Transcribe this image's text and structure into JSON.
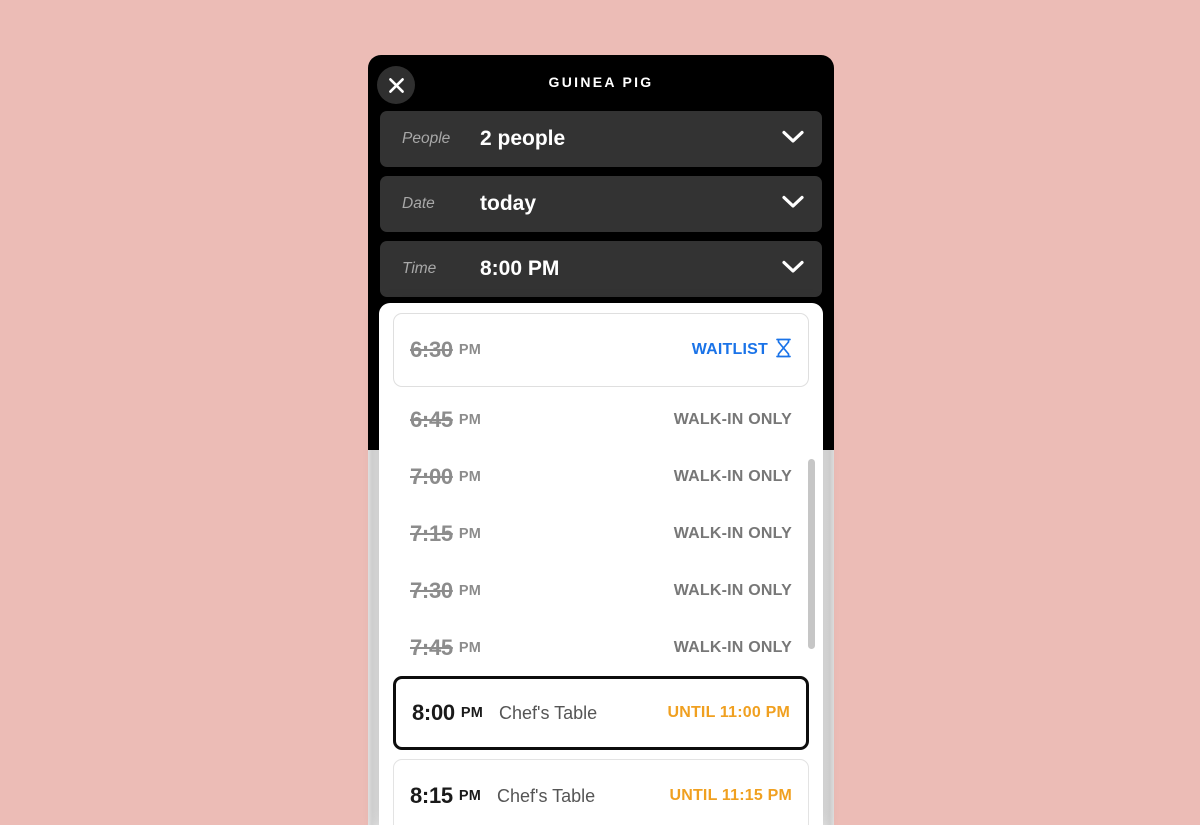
{
  "background_color": "#ecbcb6",
  "modal": {
    "title": "GUINEA PIG",
    "close_icon": "close-icon",
    "background_color": "#000000",
    "fields": [
      {
        "label": "People",
        "value": "2 people",
        "icon": "chevron-down-icon"
      },
      {
        "label": "Date",
        "value": "today",
        "icon": "chevron-down-icon"
      },
      {
        "label": "Time",
        "value": "8:00 PM",
        "icon": "chevron-down-icon"
      }
    ]
  },
  "time_dropdown": {
    "accent_waitlist": "#1a73e8",
    "accent_until": "#f0a020",
    "slots": [
      {
        "time": "6:30",
        "ampm": "PM",
        "desc": "",
        "status": "WAITLIST",
        "status_type": "waitlist",
        "icon": "hourglass-icon",
        "struck": true,
        "style": "boxed"
      },
      {
        "time": "6:45",
        "ampm": "PM",
        "desc": "",
        "status": "WALK-IN ONLY",
        "status_type": "plain",
        "icon": "",
        "struck": true,
        "style": "plain"
      },
      {
        "time": "7:00",
        "ampm": "PM",
        "desc": "",
        "status": "WALK-IN ONLY",
        "status_type": "plain",
        "icon": "",
        "struck": true,
        "style": "plain"
      },
      {
        "time": "7:15",
        "ampm": "PM",
        "desc": "",
        "status": "WALK-IN ONLY",
        "status_type": "plain",
        "icon": "",
        "struck": true,
        "style": "plain"
      },
      {
        "time": "7:30",
        "ampm": "PM",
        "desc": "",
        "status": "WALK-IN ONLY",
        "status_type": "plain",
        "icon": "",
        "struck": true,
        "style": "plain"
      },
      {
        "time": "7:45",
        "ampm": "PM",
        "desc": "",
        "status": "WALK-IN ONLY",
        "status_type": "plain",
        "icon": "",
        "struck": true,
        "style": "plain"
      },
      {
        "time": "8:00",
        "ampm": "PM",
        "desc": "Chef's Table",
        "status": "UNTIL 11:00 PM",
        "status_type": "until",
        "icon": "",
        "struck": false,
        "style": "selected"
      },
      {
        "time": "8:15",
        "ampm": "PM",
        "desc": "Chef's Table",
        "status": "UNTIL 11:15 PM",
        "status_type": "until",
        "icon": "",
        "struck": false,
        "style": "available"
      }
    ]
  }
}
